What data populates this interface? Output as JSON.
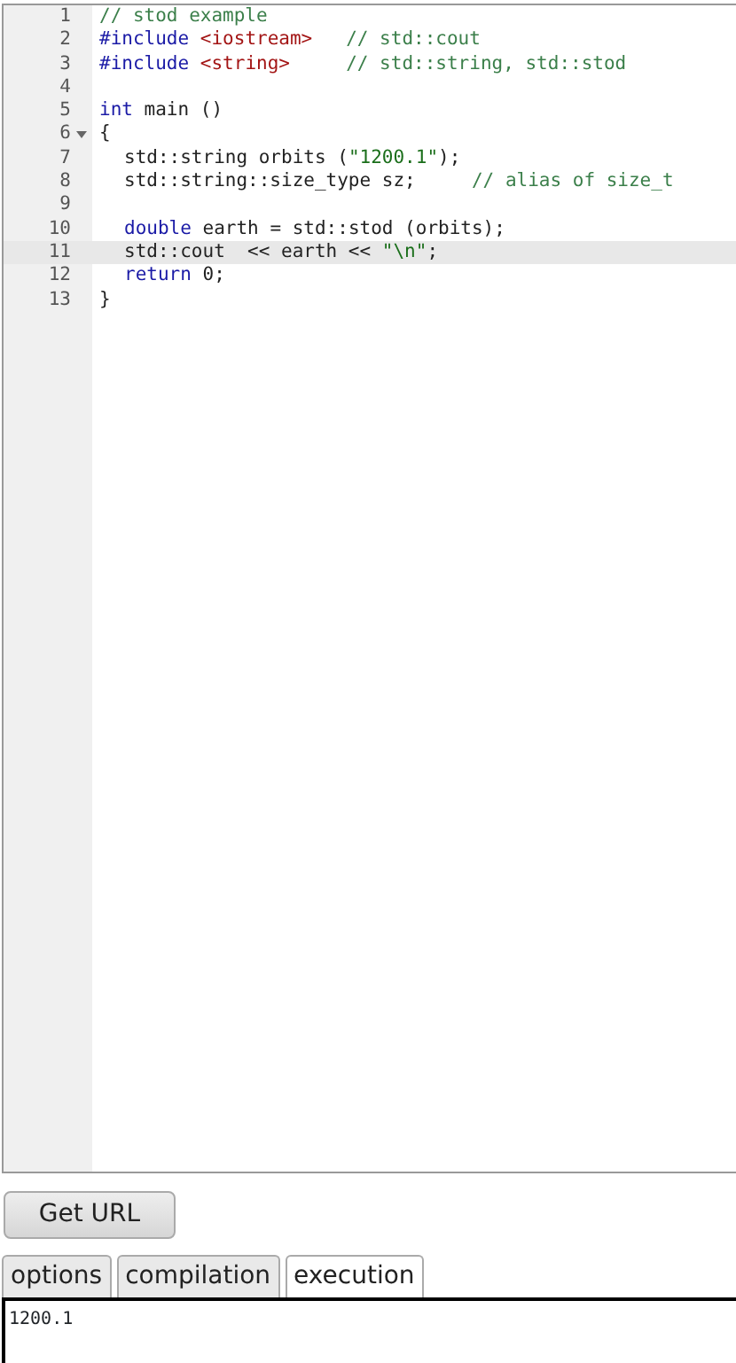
{
  "editor": {
    "lines": [
      {
        "number": "1",
        "active": false,
        "foldable": false,
        "indented": false,
        "tokens": [
          {
            "kind": "comment",
            "text": "// stod example"
          }
        ]
      },
      {
        "number": "2",
        "active": false,
        "foldable": false,
        "indented": false,
        "tokens": [
          {
            "kind": "directive",
            "text": "#include "
          },
          {
            "kind": "header",
            "text": "<iostream>"
          },
          {
            "kind": "comment",
            "text": "   // std::cout"
          }
        ]
      },
      {
        "number": "3",
        "active": false,
        "foldable": false,
        "indented": false,
        "tokens": [
          {
            "kind": "directive",
            "text": "#include "
          },
          {
            "kind": "header",
            "text": "<string>"
          },
          {
            "kind": "comment",
            "text": "     // std::string, std::stod"
          }
        ]
      },
      {
        "number": "4",
        "active": false,
        "foldable": false
      },
      {
        "number": "5",
        "active": false,
        "foldable": false,
        "indented": false,
        "tokens": [
          {
            "kind": "keyword",
            "text": "int"
          },
          {
            "kind": "plain",
            "text": " main ()"
          }
        ]
      },
      {
        "number": "6",
        "active": false,
        "foldable": true,
        "indented": false,
        "tokens": [
          {
            "kind": "plain",
            "text": "{"
          }
        ]
      },
      {
        "number": "7",
        "active": false,
        "foldable": false,
        "indented": true,
        "tokens": [
          {
            "kind": "plain",
            "text": "std::string orbits ("
          },
          {
            "kind": "string",
            "text": "\"1200.1\""
          },
          {
            "kind": "plain",
            "text": ");"
          }
        ]
      },
      {
        "number": "8",
        "active": false,
        "foldable": false,
        "indented": true,
        "tokens": [
          {
            "kind": "plain",
            "text": "std::string::size_type sz;"
          },
          {
            "kind": "comment",
            "text": "     // alias of size_t"
          }
        ]
      },
      {
        "number": "9",
        "active": false,
        "foldable": false
      },
      {
        "number": "10",
        "active": false,
        "foldable": false,
        "indented": true,
        "tokens": [
          {
            "kind": "keyword",
            "text": "double"
          },
          {
            "kind": "plain",
            "text": " earth = std::stod (orbits);"
          }
        ]
      },
      {
        "number": "11",
        "active": true,
        "foldable": false,
        "indented": true,
        "tokens": [
          {
            "kind": "plain",
            "text": "std::cout  << earth << "
          },
          {
            "kind": "string",
            "text": "\"\\n\""
          },
          {
            "kind": "plain",
            "text": ";"
          }
        ]
      },
      {
        "number": "12",
        "active": false,
        "foldable": false,
        "indented": true,
        "tokens": [
          {
            "kind": "keyword",
            "text": "return"
          },
          {
            "kind": "plain",
            "text": " 0;"
          }
        ]
      },
      {
        "number": "13",
        "active": false,
        "foldable": false,
        "indented": false,
        "tokens": [
          {
            "kind": "plain",
            "text": "}"
          }
        ]
      }
    ]
  },
  "get_url_button": {
    "label": "Get URL"
  },
  "tabs": [
    {
      "label": "options",
      "selected": false
    },
    {
      "label": "compilation",
      "selected": false
    },
    {
      "label": "execution",
      "selected": true
    }
  ],
  "output": {
    "text": "1200.1"
  }
}
